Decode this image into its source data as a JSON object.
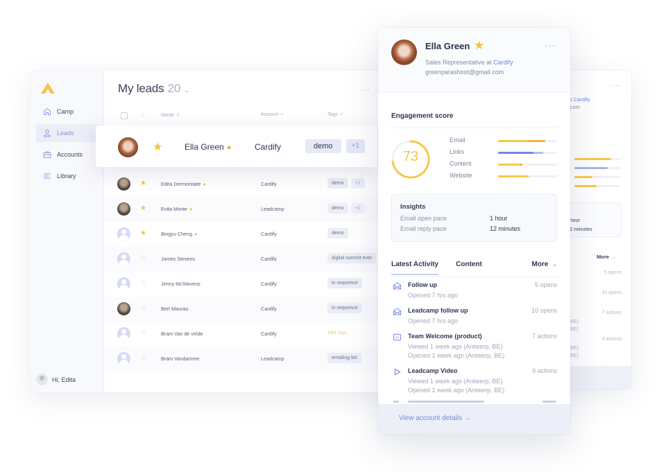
{
  "app": {
    "sidebar": {
      "items": [
        {
          "label": "Camp",
          "icon": "home-icon",
          "active": false
        },
        {
          "label": "Leads",
          "icon": "user-icon",
          "active": true
        },
        {
          "label": "Accounts",
          "icon": "briefcase-icon",
          "active": false
        },
        {
          "label": "Library",
          "icon": "list-icon",
          "active": false
        }
      ],
      "user_greeting": "Hi, Edita"
    },
    "header": {
      "title": "My leads",
      "count": "20",
      "more_label": "···"
    },
    "table": {
      "columns": {
        "name": "Name",
        "account": "Account",
        "tags": "Tags"
      },
      "highlighted_row": {
        "name": "Ella Green",
        "account": "Cardify",
        "starred": true,
        "hot": true,
        "tags": [
          "demo"
        ],
        "extra_tags": "+1"
      },
      "rows": [
        {
          "name": "Edita Dermontaite",
          "account": "Cardify",
          "starred": true,
          "hot": true,
          "avatar": "photo",
          "tags": [
            "demo"
          ],
          "extra_tags": "+1"
        },
        {
          "name": "Evita Monte",
          "account": "Leadcamp",
          "starred": true,
          "hot": true,
          "avatar": "photo",
          "tags": [
            "demo"
          ],
          "extra_tags": "+1"
        },
        {
          "name": "Bingyu Cheng",
          "account": "Cardify",
          "starred": true,
          "hot": true,
          "avatar": "placeholder",
          "tags": [
            "demo"
          ],
          "extra_tags": ""
        },
        {
          "name": "James Stevens",
          "account": "Cardify",
          "starred": false,
          "hot": false,
          "avatar": "placeholder",
          "tags": [
            "digital summit ever"
          ],
          "extra_tags": ""
        },
        {
          "name": "Jenny McStevens",
          "account": "Cardify",
          "starred": false,
          "hot": false,
          "avatar": "placeholder",
          "tags": [
            "in sequence"
          ],
          "extra_tags": ""
        },
        {
          "name": "Bert Maurau",
          "account": "Cardify",
          "starred": false,
          "hot": false,
          "avatar": "photo",
          "tags": [
            "in sequence"
          ],
          "extra_tags": ""
        },
        {
          "name": "Bram Van de velde",
          "account": "Cardify",
          "starred": false,
          "hot": false,
          "avatar": "placeholder",
          "tags": [],
          "add_tags_label": "Add tags",
          "extra_tags": ""
        },
        {
          "name": "Bram Vandamme",
          "account": "Leadcamp",
          "starred": false,
          "hot": false,
          "avatar": "placeholder",
          "tags": [
            "emailing list"
          ],
          "extra_tags": ""
        }
      ]
    }
  },
  "detail_card": {
    "name": "Ella Green",
    "starred": true,
    "role_prefix": "Sales Representative at ",
    "company": "Cardify",
    "email": "greenparashoot@gmail.com",
    "more_label": "···",
    "engagement": {
      "title": "Engagement score",
      "score": 73,
      "metrics": [
        {
          "label": "Email",
          "value": 0.52,
          "secondary": 0.8,
          "color": "#f7c948"
        },
        {
          "label": "Links",
          "value": 0.6,
          "secondary": 0.76,
          "color": "#7184e6"
        },
        {
          "label": "Content",
          "value": 0.36,
          "secondary": 0.41,
          "color": "#f7c948"
        },
        {
          "label": "Website",
          "value": 0.52,
          "secondary": 0.52,
          "color": "#f7c948"
        }
      ]
    },
    "insights": {
      "title": "Insights",
      "rows": [
        {
          "label": "Email open pace",
          "value": "1 hour"
        },
        {
          "label": "Email reply pace",
          "value": "12 minutes"
        }
      ]
    },
    "tabs": [
      {
        "label": "Latest Activity",
        "active": true
      },
      {
        "label": "Content",
        "active": false
      }
    ],
    "tabs_more": "More",
    "activity": [
      {
        "icon": "email-open-icon",
        "title": "Follow up",
        "count": "5 opens",
        "details": [
          "Opened 7 hrs ago"
        ]
      },
      {
        "icon": "email-open-icon",
        "title": "Leadcamp follow up",
        "count": "10 opens",
        "details": [
          "Opened 7 hrs ago"
        ]
      },
      {
        "icon": "pdf-icon",
        "title": "Team Welcome (product)",
        "count": "7 actions",
        "details": [
          "Viewed 1 week ago  (Antwerp, BE)",
          "Opened 1 week ago  (Antwerp, BE)"
        ]
      },
      {
        "icon": "play-icon",
        "title": "Leadcamp Video",
        "count": "9 actions",
        "details": [
          "Viewed 1 week ago  (Antwerp, BE)",
          "Opened 1 week ago  (Antwerp, BE)"
        ]
      }
    ],
    "footer_link": "View account details →"
  },
  "back_card": {
    "role_fragment": "e at ",
    "company": "Cardify",
    "email_fragment": "ail.com",
    "insight_values": [
      "hour",
      "2 minutes"
    ],
    "tabs_more": "More",
    "counts": [
      "5 opens",
      "10 opens",
      "7 actions",
      "9 actions"
    ],
    "location_fragments": [
      "rp, BE)",
      "rp, BE)",
      "rp, BE)",
      "rp, BE)"
    ]
  },
  "colors": {
    "accent": "#7184e6",
    "score": "#f4c44c",
    "star": "#f3c13a",
    "hot": "#f0b64a"
  }
}
